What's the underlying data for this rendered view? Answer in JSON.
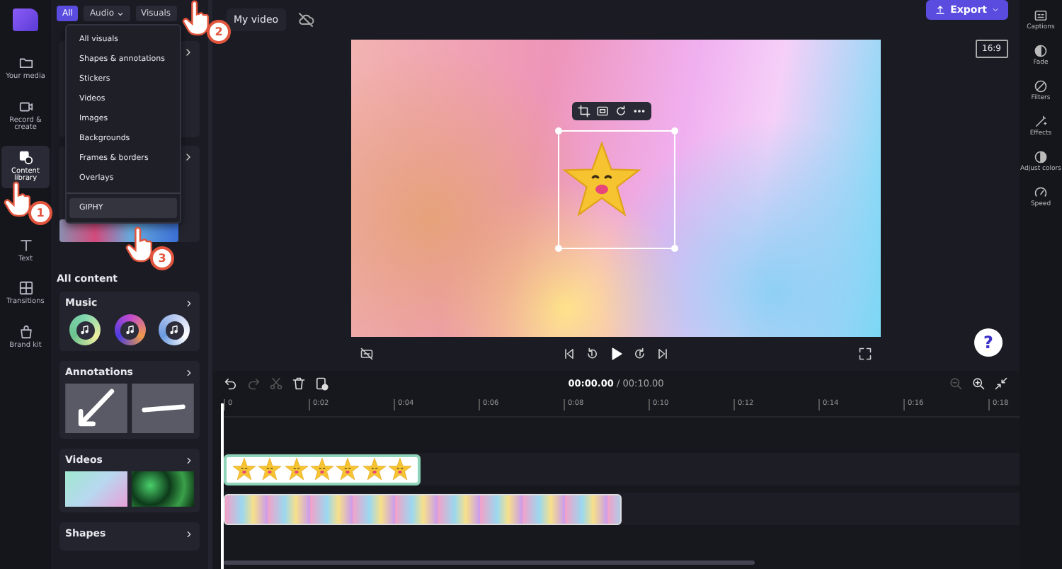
{
  "nav": [
    {
      "label": "Your media",
      "selected": false
    },
    {
      "label": "Record & create",
      "selected": false
    },
    {
      "label": "Content library",
      "selected": true
    },
    {
      "label": "Text",
      "selected": false
    },
    {
      "label": "Transitions",
      "selected": false
    },
    {
      "label": "Brand kit",
      "selected": false
    }
  ],
  "filters": [
    {
      "label": "All",
      "selected": true,
      "dropdown": false
    },
    {
      "label": "Audio",
      "selected": false,
      "dropdown": true
    },
    {
      "label": "Visuals",
      "selected": false,
      "dropdown": false
    }
  ],
  "menu": {
    "items": [
      {
        "label": "All visuals",
        "highlighted": false
      },
      {
        "label": "Shapes & annotations",
        "highlighted": false
      },
      {
        "label": "Stickers",
        "highlighted": false
      },
      {
        "label": "Videos",
        "highlighted": false
      },
      {
        "label": "Images",
        "highlighted": false
      },
      {
        "label": "Backgrounds",
        "highlighted": false
      },
      {
        "label": "Frames & borders",
        "highlighted": false
      },
      {
        "label": "Overlays",
        "highlighted": false
      }
    ],
    "footer_items": [
      {
        "label": "GIPHY",
        "highlighted": true
      }
    ]
  },
  "steps": [
    "1",
    "2",
    "3"
  ],
  "library": {
    "heading": "All content",
    "sections": [
      {
        "title": "Music",
        "kind": "music"
      },
      {
        "title": "Annotations",
        "kind": "annotations"
      },
      {
        "title": "Videos",
        "kind": "videos"
      },
      {
        "title": "Shapes",
        "kind": "shapes"
      }
    ]
  },
  "project": {
    "title": "My video"
  },
  "export": {
    "label": "Export"
  },
  "aspect": "16:9",
  "help": "?",
  "timeline": {
    "time": "**00:00.00** / 00:10.00",
    "tools": [
      {
        "kind": "undo",
        "disabled": false
      },
      {
        "kind": "redo",
        "disabled": true
      },
      {
        "kind": "cut",
        "disabled": true
      },
      {
        "kind": "delete",
        "disabled": false
      },
      {
        "kind": "duplicate",
        "disabled": false
      }
    ],
    "zoom": [
      {
        "kind": "zoom-out",
        "disabled": true
      },
      {
        "kind": "zoom-in",
        "disabled": false
      },
      {
        "kind": "fit",
        "disabled": false
      }
    ],
    "ruler": [
      "0",
      "0:02",
      "0:04",
      "0:06",
      "0:08",
      "0:10",
      "0:12",
      "0:14",
      "0:16",
      "0:18"
    ]
  },
  "right_panel": [
    {
      "label": "Captions"
    },
    {
      "label": "Fade"
    },
    {
      "label": "Filters"
    },
    {
      "label": "Effects"
    },
    {
      "label": "Adjust colors"
    },
    {
      "label": "Speed"
    }
  ]
}
